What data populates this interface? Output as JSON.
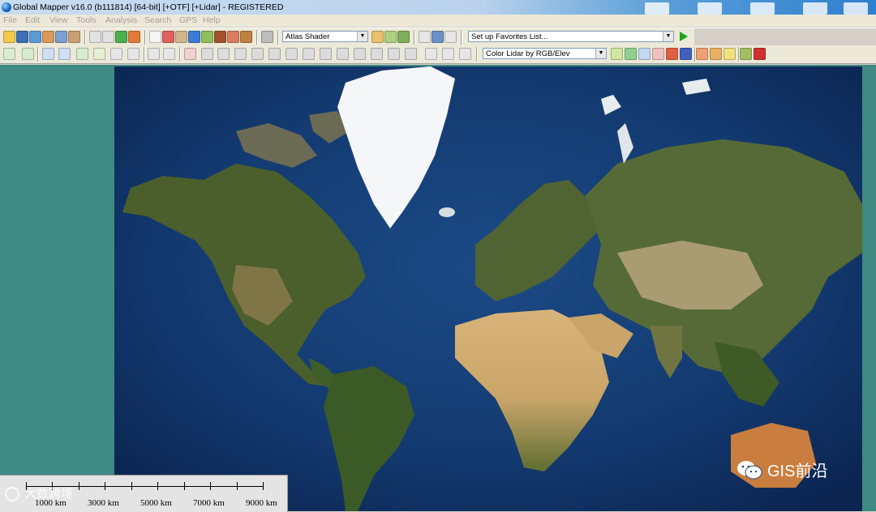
{
  "window": {
    "title": "Global Mapper v16.0 (b111814) [64-bit] [+OTF] [+Lidar] - REGISTERED"
  },
  "menu": [
    "File",
    "Edit",
    "View",
    "Tools",
    "Analysis",
    "Search",
    "GPS",
    "Help"
  ],
  "toolbar": {
    "shader_value": "Atlas Shader",
    "favorites_value": "Set up Favorites List...",
    "lidar_color_value": "Color Lidar by RGB/Elev"
  },
  "scalebar": {
    "labels": [
      "1000 km",
      "3000 km",
      "5000 km",
      "7000 km",
      "9000 km"
    ]
  },
  "watermarks": {
    "left": "大数跨境",
    "right": "GIS前沿"
  },
  "colors": {
    "map_background": "#3f8a82",
    "ocean": "#0e2a56",
    "title_accent": "#2f7fd0"
  }
}
